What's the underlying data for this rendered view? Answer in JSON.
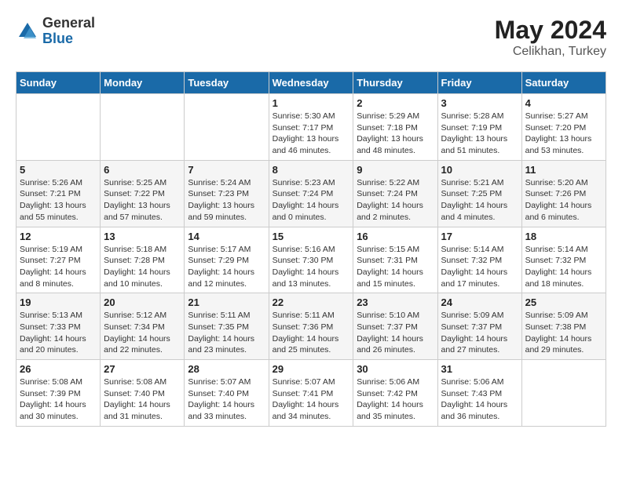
{
  "header": {
    "logo_general": "General",
    "logo_blue": "Blue",
    "month_year": "May 2024",
    "location": "Celikhan, Turkey"
  },
  "days_of_week": [
    "Sunday",
    "Monday",
    "Tuesday",
    "Wednesday",
    "Thursday",
    "Friday",
    "Saturday"
  ],
  "weeks": [
    [
      {
        "day": "",
        "info": ""
      },
      {
        "day": "",
        "info": ""
      },
      {
        "day": "",
        "info": ""
      },
      {
        "day": "1",
        "info": "Sunrise: 5:30 AM\nSunset: 7:17 PM\nDaylight: 13 hours\nand 46 minutes."
      },
      {
        "day": "2",
        "info": "Sunrise: 5:29 AM\nSunset: 7:18 PM\nDaylight: 13 hours\nand 48 minutes."
      },
      {
        "day": "3",
        "info": "Sunrise: 5:28 AM\nSunset: 7:19 PM\nDaylight: 13 hours\nand 51 minutes."
      },
      {
        "day": "4",
        "info": "Sunrise: 5:27 AM\nSunset: 7:20 PM\nDaylight: 13 hours\nand 53 minutes."
      }
    ],
    [
      {
        "day": "5",
        "info": "Sunrise: 5:26 AM\nSunset: 7:21 PM\nDaylight: 13 hours\nand 55 minutes."
      },
      {
        "day": "6",
        "info": "Sunrise: 5:25 AM\nSunset: 7:22 PM\nDaylight: 13 hours\nand 57 minutes."
      },
      {
        "day": "7",
        "info": "Sunrise: 5:24 AM\nSunset: 7:23 PM\nDaylight: 13 hours\nand 59 minutes."
      },
      {
        "day": "8",
        "info": "Sunrise: 5:23 AM\nSunset: 7:24 PM\nDaylight: 14 hours\nand 0 minutes."
      },
      {
        "day": "9",
        "info": "Sunrise: 5:22 AM\nSunset: 7:24 PM\nDaylight: 14 hours\nand 2 minutes."
      },
      {
        "day": "10",
        "info": "Sunrise: 5:21 AM\nSunset: 7:25 PM\nDaylight: 14 hours\nand 4 minutes."
      },
      {
        "day": "11",
        "info": "Sunrise: 5:20 AM\nSunset: 7:26 PM\nDaylight: 14 hours\nand 6 minutes."
      }
    ],
    [
      {
        "day": "12",
        "info": "Sunrise: 5:19 AM\nSunset: 7:27 PM\nDaylight: 14 hours\nand 8 minutes."
      },
      {
        "day": "13",
        "info": "Sunrise: 5:18 AM\nSunset: 7:28 PM\nDaylight: 14 hours\nand 10 minutes."
      },
      {
        "day": "14",
        "info": "Sunrise: 5:17 AM\nSunset: 7:29 PM\nDaylight: 14 hours\nand 12 minutes."
      },
      {
        "day": "15",
        "info": "Sunrise: 5:16 AM\nSunset: 7:30 PM\nDaylight: 14 hours\nand 13 minutes."
      },
      {
        "day": "16",
        "info": "Sunrise: 5:15 AM\nSunset: 7:31 PM\nDaylight: 14 hours\nand 15 minutes."
      },
      {
        "day": "17",
        "info": "Sunrise: 5:14 AM\nSunset: 7:32 PM\nDaylight: 14 hours\nand 17 minutes."
      },
      {
        "day": "18",
        "info": "Sunrise: 5:14 AM\nSunset: 7:32 PM\nDaylight: 14 hours\nand 18 minutes."
      }
    ],
    [
      {
        "day": "19",
        "info": "Sunrise: 5:13 AM\nSunset: 7:33 PM\nDaylight: 14 hours\nand 20 minutes."
      },
      {
        "day": "20",
        "info": "Sunrise: 5:12 AM\nSunset: 7:34 PM\nDaylight: 14 hours\nand 22 minutes."
      },
      {
        "day": "21",
        "info": "Sunrise: 5:11 AM\nSunset: 7:35 PM\nDaylight: 14 hours\nand 23 minutes."
      },
      {
        "day": "22",
        "info": "Sunrise: 5:11 AM\nSunset: 7:36 PM\nDaylight: 14 hours\nand 25 minutes."
      },
      {
        "day": "23",
        "info": "Sunrise: 5:10 AM\nSunset: 7:37 PM\nDaylight: 14 hours\nand 26 minutes."
      },
      {
        "day": "24",
        "info": "Sunrise: 5:09 AM\nSunset: 7:37 PM\nDaylight: 14 hours\nand 27 minutes."
      },
      {
        "day": "25",
        "info": "Sunrise: 5:09 AM\nSunset: 7:38 PM\nDaylight: 14 hours\nand 29 minutes."
      }
    ],
    [
      {
        "day": "26",
        "info": "Sunrise: 5:08 AM\nSunset: 7:39 PM\nDaylight: 14 hours\nand 30 minutes."
      },
      {
        "day": "27",
        "info": "Sunrise: 5:08 AM\nSunset: 7:40 PM\nDaylight: 14 hours\nand 31 minutes."
      },
      {
        "day": "28",
        "info": "Sunrise: 5:07 AM\nSunset: 7:40 PM\nDaylight: 14 hours\nand 33 minutes."
      },
      {
        "day": "29",
        "info": "Sunrise: 5:07 AM\nSunset: 7:41 PM\nDaylight: 14 hours\nand 34 minutes."
      },
      {
        "day": "30",
        "info": "Sunrise: 5:06 AM\nSunset: 7:42 PM\nDaylight: 14 hours\nand 35 minutes."
      },
      {
        "day": "31",
        "info": "Sunrise: 5:06 AM\nSunset: 7:43 PM\nDaylight: 14 hours\nand 36 minutes."
      },
      {
        "day": "",
        "info": ""
      }
    ]
  ]
}
